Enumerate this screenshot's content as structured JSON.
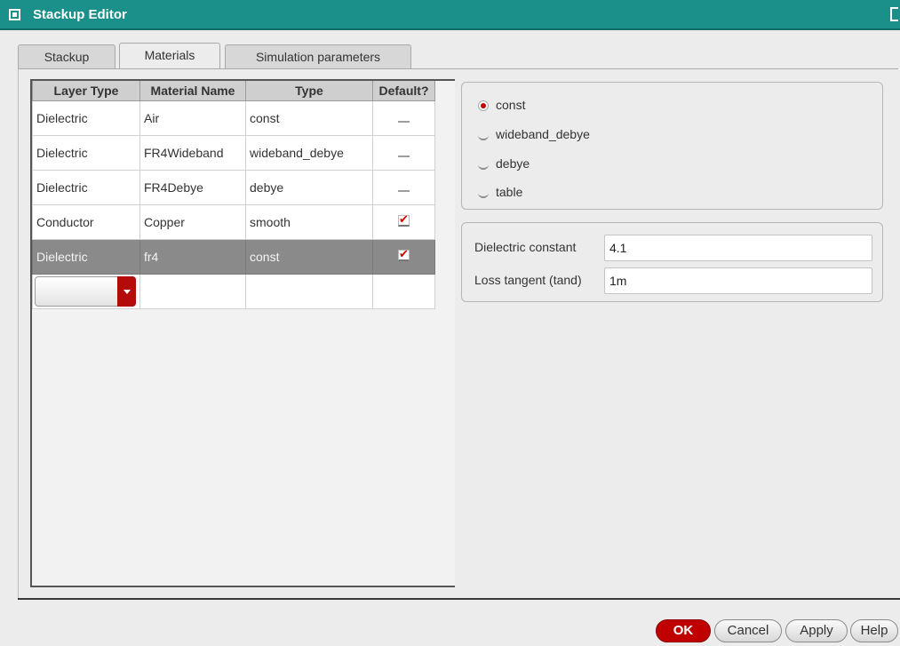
{
  "window": {
    "title": "Stackup Editor"
  },
  "tabs": [
    {
      "label": "Stackup",
      "active": false
    },
    {
      "label": "Materials",
      "active": true
    },
    {
      "label": "Simulation parameters",
      "active": false
    }
  ],
  "table": {
    "columns": [
      "Layer Type",
      "Material Name",
      "Type",
      "Default?"
    ],
    "rows": [
      {
        "layer_type": "Dielectric",
        "material_name": "Air",
        "type": "const",
        "default": false,
        "selected": false
      },
      {
        "layer_type": "Dielectric",
        "material_name": "FR4Wideband",
        "type": "wideband_debye",
        "default": false,
        "selected": false
      },
      {
        "layer_type": "Dielectric",
        "material_name": "FR4Debye",
        "type": "debye",
        "default": false,
        "selected": false
      },
      {
        "layer_type": "Conductor",
        "material_name": "Copper",
        "type": "smooth",
        "default": true,
        "selected": false
      },
      {
        "layer_type": "Dielectric",
        "material_name": "fr4",
        "type": "const",
        "default": true,
        "selected": true
      }
    ]
  },
  "model_types": {
    "options": [
      "const",
      "wideband_debye",
      "debye",
      "table"
    ],
    "selected": "const"
  },
  "properties": {
    "dielectric_constant": {
      "label": "Dielectric constant",
      "value": "4.1"
    },
    "loss_tangent": {
      "label": "Loss tangent (tand)",
      "value": "1m"
    }
  },
  "buttons": {
    "ok": "OK",
    "cancel": "Cancel",
    "apply": "Apply",
    "help": "Help"
  },
  "colors": {
    "titlebar": "#1b8f8a",
    "accent": "#c00000",
    "selected_row": "#8a8a8a"
  }
}
